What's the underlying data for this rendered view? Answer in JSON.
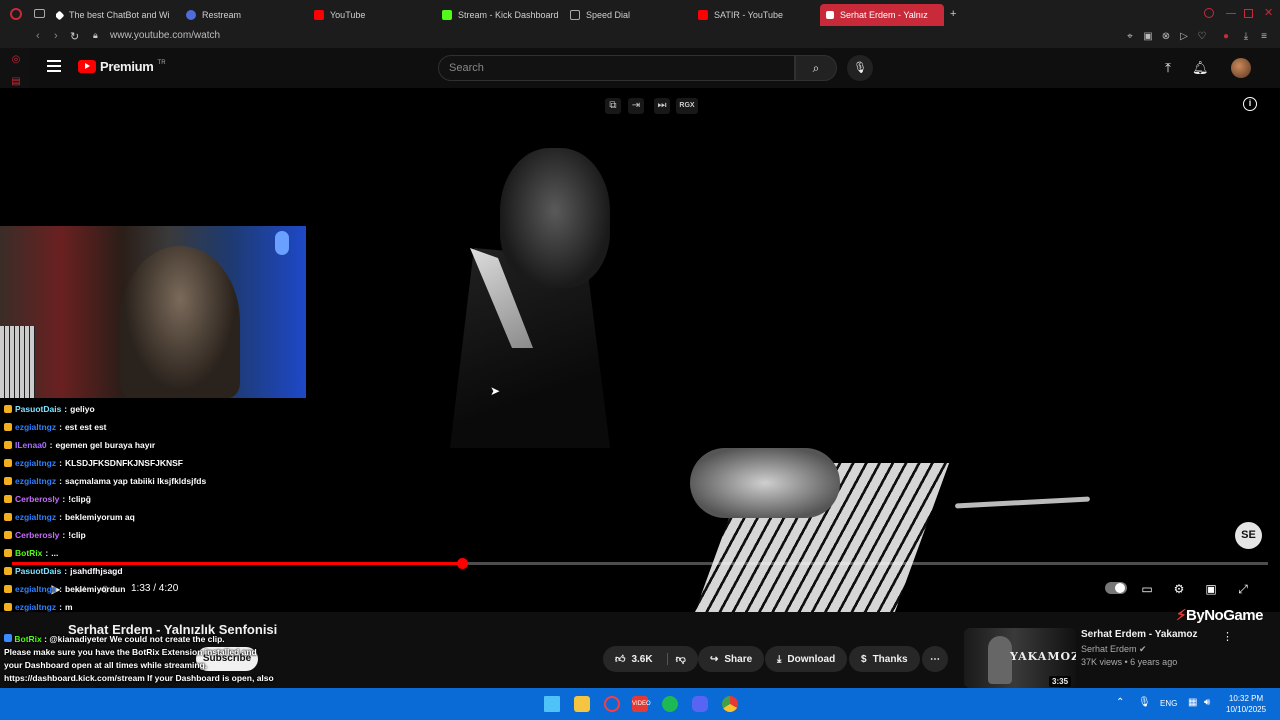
{
  "browser": {
    "tabs": [
      {
        "label": "The best ChatBot and Wi",
        "color": "#ffffff"
      },
      {
        "label": "Restream",
        "color": "#4f6bdc"
      },
      {
        "label": "YouTube",
        "color": "#ff0000"
      },
      {
        "label": "Stream - Kick Dashboard",
        "color": "#53fc18"
      },
      {
        "label": "Speed Dial",
        "color": "#888888"
      },
      {
        "label": "SATIR - YouTube",
        "color": "#ff0000"
      },
      {
        "label": "Serhat Erdem - Yalnız",
        "color": "#ffffff"
      }
    ],
    "url": "www.youtube.com/watch",
    "accent": "#c92a3a"
  },
  "youtube": {
    "logo_text": "Premium",
    "logo_region": "TR",
    "search_placeholder": "Search",
    "video": {
      "title": "Serhat Erdem - Yalnızlık Senfonisi",
      "current_time": "1:33 / 4:20",
      "progress": 0.358,
      "channel_watermark": "SE",
      "top_icon_label": "RGX"
    },
    "subscribe_label": "Subscribe",
    "actions": {
      "likes": "3.6K",
      "share": "Share",
      "download": "Download",
      "thanks": "Thanks"
    },
    "recommended": {
      "thumb_text": "YAKAMOZ",
      "title": "Serhat Erdem - Yakamoz",
      "channel": "Serhat Erdem",
      "meta": "37K views • 6 years ago",
      "duration": "3:35"
    },
    "sponsor_logo": "ByNoGame"
  },
  "chat": {
    "lines": [
      {
        "user": "PasuotDais",
        "msg": "geliyo",
        "color": "#7fe3ff"
      },
      {
        "user": "ezgialtngz",
        "msg": "est est est",
        "color": "#2f7fff"
      },
      {
        "user": "ILenaa0",
        "msg": "egemen gel buraya hayır",
        "color": "#a970ff"
      },
      {
        "user": "ezgialtngz",
        "msg": "KLSDJFKSDNFKJNSFJKNSF",
        "color": "#2f7fff"
      },
      {
        "user": "ezgialtngz",
        "msg": "saçmalama yap tabiiki lksjfkldsjfds",
        "color": "#2f7fff"
      },
      {
        "user": "Cerberosly",
        "msg": "!clipğ",
        "color": "#c86cff"
      },
      {
        "user": "ezgialtngz",
        "msg": "beklemiyorum aq",
        "color": "#2f7fff"
      },
      {
        "user": "Cerberosly",
        "msg": "!clip",
        "color": "#c86cff"
      },
      {
        "user": "BotRix",
        "msg": "...",
        "color": "#53fc18"
      },
      {
        "user": "PasuotDais",
        "msg": "jsahdfhjsagd",
        "color": "#7fe3ff"
      },
      {
        "user": "ezgialtngz",
        "msg": "beklemiyordun",
        "color": "#2f7fff"
      },
      {
        "user": "ezgialtngz",
        "msg": "m",
        "color": "#2f7fff"
      }
    ],
    "bot_user": "BotRix",
    "bot_line": "@kianadiyeter We could not create the clip.",
    "bot_body": "Please make sure you have the BotRix Extension installed and your Dashboard open at all times while streaming. https://dashboard.kick.com/stream If your Dashboard is open, also check that the icon is displayed in green to ensure clipping is active."
  },
  "taskbar": {
    "lang": "ENG",
    "time": "10:32 PM",
    "date": "10/10/2025"
  }
}
